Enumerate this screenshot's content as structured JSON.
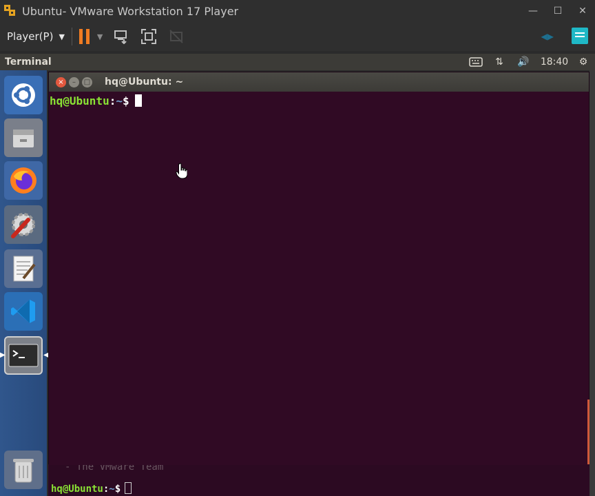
{
  "vmware": {
    "title": "Ubuntu- VMware Workstation 17 Player",
    "menu_label": "Player(P)",
    "window_controls": [
      "minimize",
      "maximize",
      "close"
    ]
  },
  "panel": {
    "title": "Terminal",
    "time": "18:40",
    "indicators": [
      "keyboard-icon",
      "network-icon",
      "volume-icon",
      "gear-icon"
    ]
  },
  "launcher": {
    "items": [
      {
        "name": "dash"
      },
      {
        "name": "files"
      },
      {
        "name": "firefox"
      },
      {
        "name": "system-settings"
      },
      {
        "name": "text-editor"
      },
      {
        "name": "vscode"
      },
      {
        "name": "terminal"
      },
      {
        "name": "trash"
      }
    ]
  },
  "terminal": {
    "title": "hq@Ubuntu: ~",
    "prompt": {
      "user": "hq@Ubuntu",
      "colon": ":",
      "path": "~",
      "symbol": "$"
    }
  },
  "background_terminal": {
    "partial_text": "- The VMware Team",
    "prompt": {
      "user": "hq@Ubuntu",
      "colon": ":",
      "path": "~",
      "symbol": "$"
    }
  },
  "colors": {
    "terminal_bg": "#300a24",
    "prompt_user": "#8ae234",
    "prompt_path": "#729fcf",
    "pause_accent": "#f07c22",
    "launcher_bg": "#2c4a7c"
  }
}
